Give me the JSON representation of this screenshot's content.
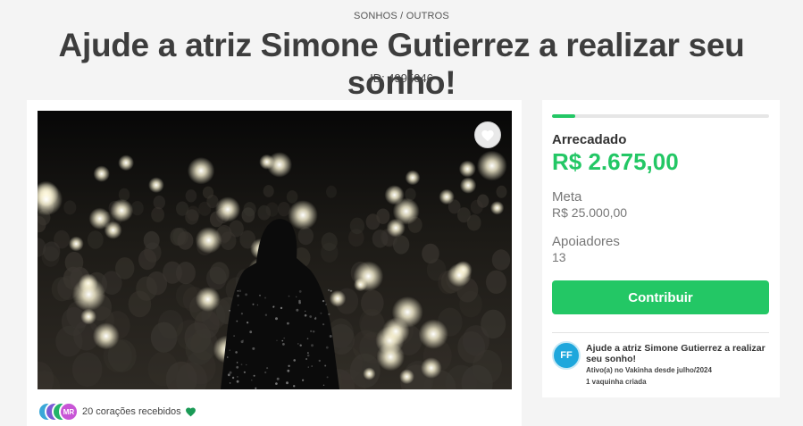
{
  "header": {
    "category": "SONHOS / OUTROS",
    "title": "Ajude a atriz Simone Gutierrez a realizar seu sonho!",
    "id_text": "ID: 4995046"
  },
  "media": {
    "hearts": {
      "avatars": [
        {
          "initials": "",
          "color": "#3aa8d8"
        },
        {
          "initials": "",
          "color": "#7b5bd6"
        },
        {
          "initials": "",
          "color": "#23b36b"
        },
        {
          "initials": "MR",
          "color": "#c855d6"
        }
      ],
      "count_text": "20 corações recebidos"
    }
  },
  "stats": {
    "progress_fraction": 0.107,
    "raised_label": "Arrecadado",
    "raised_value": "R$ 2.675,00",
    "goal_label": "Meta",
    "goal_value": "R$ 25.000,00",
    "supporters_label": "Apoiadores",
    "supporters_value": "13"
  },
  "actions": {
    "contribute_label": "Contribuir"
  },
  "creator": {
    "initials": "FF",
    "campaign_name": "Ajude a atriz Simone Gutierrez a realizar seu sonho!",
    "active_since": "Ativo(a) no Vakinha desde julho/2024",
    "campaigns_created": "1 vaquinha criada"
  },
  "colors": {
    "accent": "#23c765",
    "creator_avatar": "#1ea7dc"
  }
}
